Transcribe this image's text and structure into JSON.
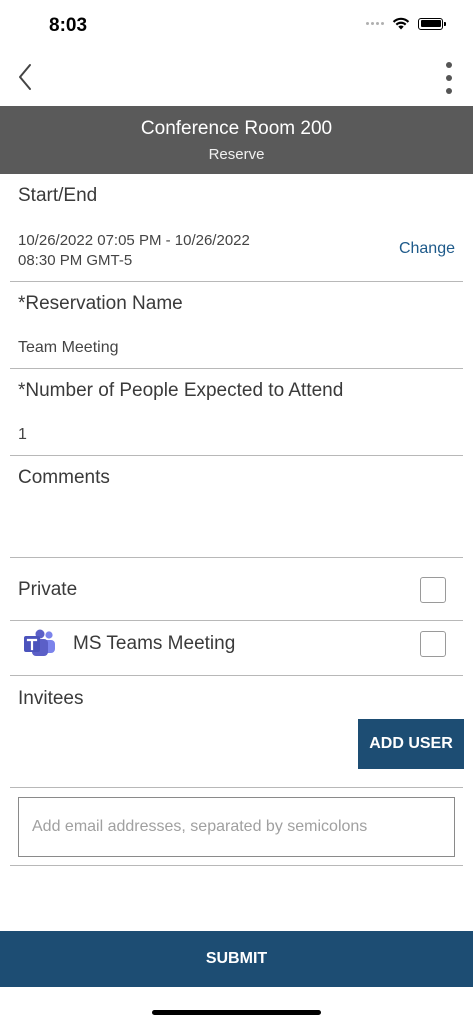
{
  "status_bar": {
    "time": "8:03",
    "icons": [
      "signal-icon",
      "wifi-icon",
      "battery-icon"
    ]
  },
  "nav": {
    "back_icon": "chevron-left-icon",
    "more_icon": "more-vertical-icon"
  },
  "header": {
    "title": "Conference Room 200",
    "subtitle": "Reserve"
  },
  "start_end": {
    "label": "Start/End",
    "value_line1": "10/26/2022 07:05 PM - 10/26/2022",
    "value_line2": "08:30 PM  GMT-5",
    "change_label": "Change"
  },
  "reservation_name": {
    "label": "*Reservation Name",
    "value": "Team Meeting"
  },
  "attendees": {
    "label": "*Number of People Expected to Attend",
    "value": "1"
  },
  "comments": {
    "label": "Comments",
    "value": ""
  },
  "private": {
    "label": "Private",
    "checked": false
  },
  "teams_meeting": {
    "label": "MS Teams Meeting",
    "icon": "ms-teams-icon",
    "checked": false
  },
  "invitees": {
    "label": "Invitees",
    "add_user_label": "ADD USER",
    "email_placeholder": "Add email addresses, separated by semicolons",
    "email_value": ""
  },
  "submit": {
    "label": "SUBMIT"
  },
  "colors": {
    "header_bg": "#5a5a5a",
    "primary": "#1d4d73",
    "link": "#1e5a8a",
    "teams_purple": "#5b5fc7"
  }
}
